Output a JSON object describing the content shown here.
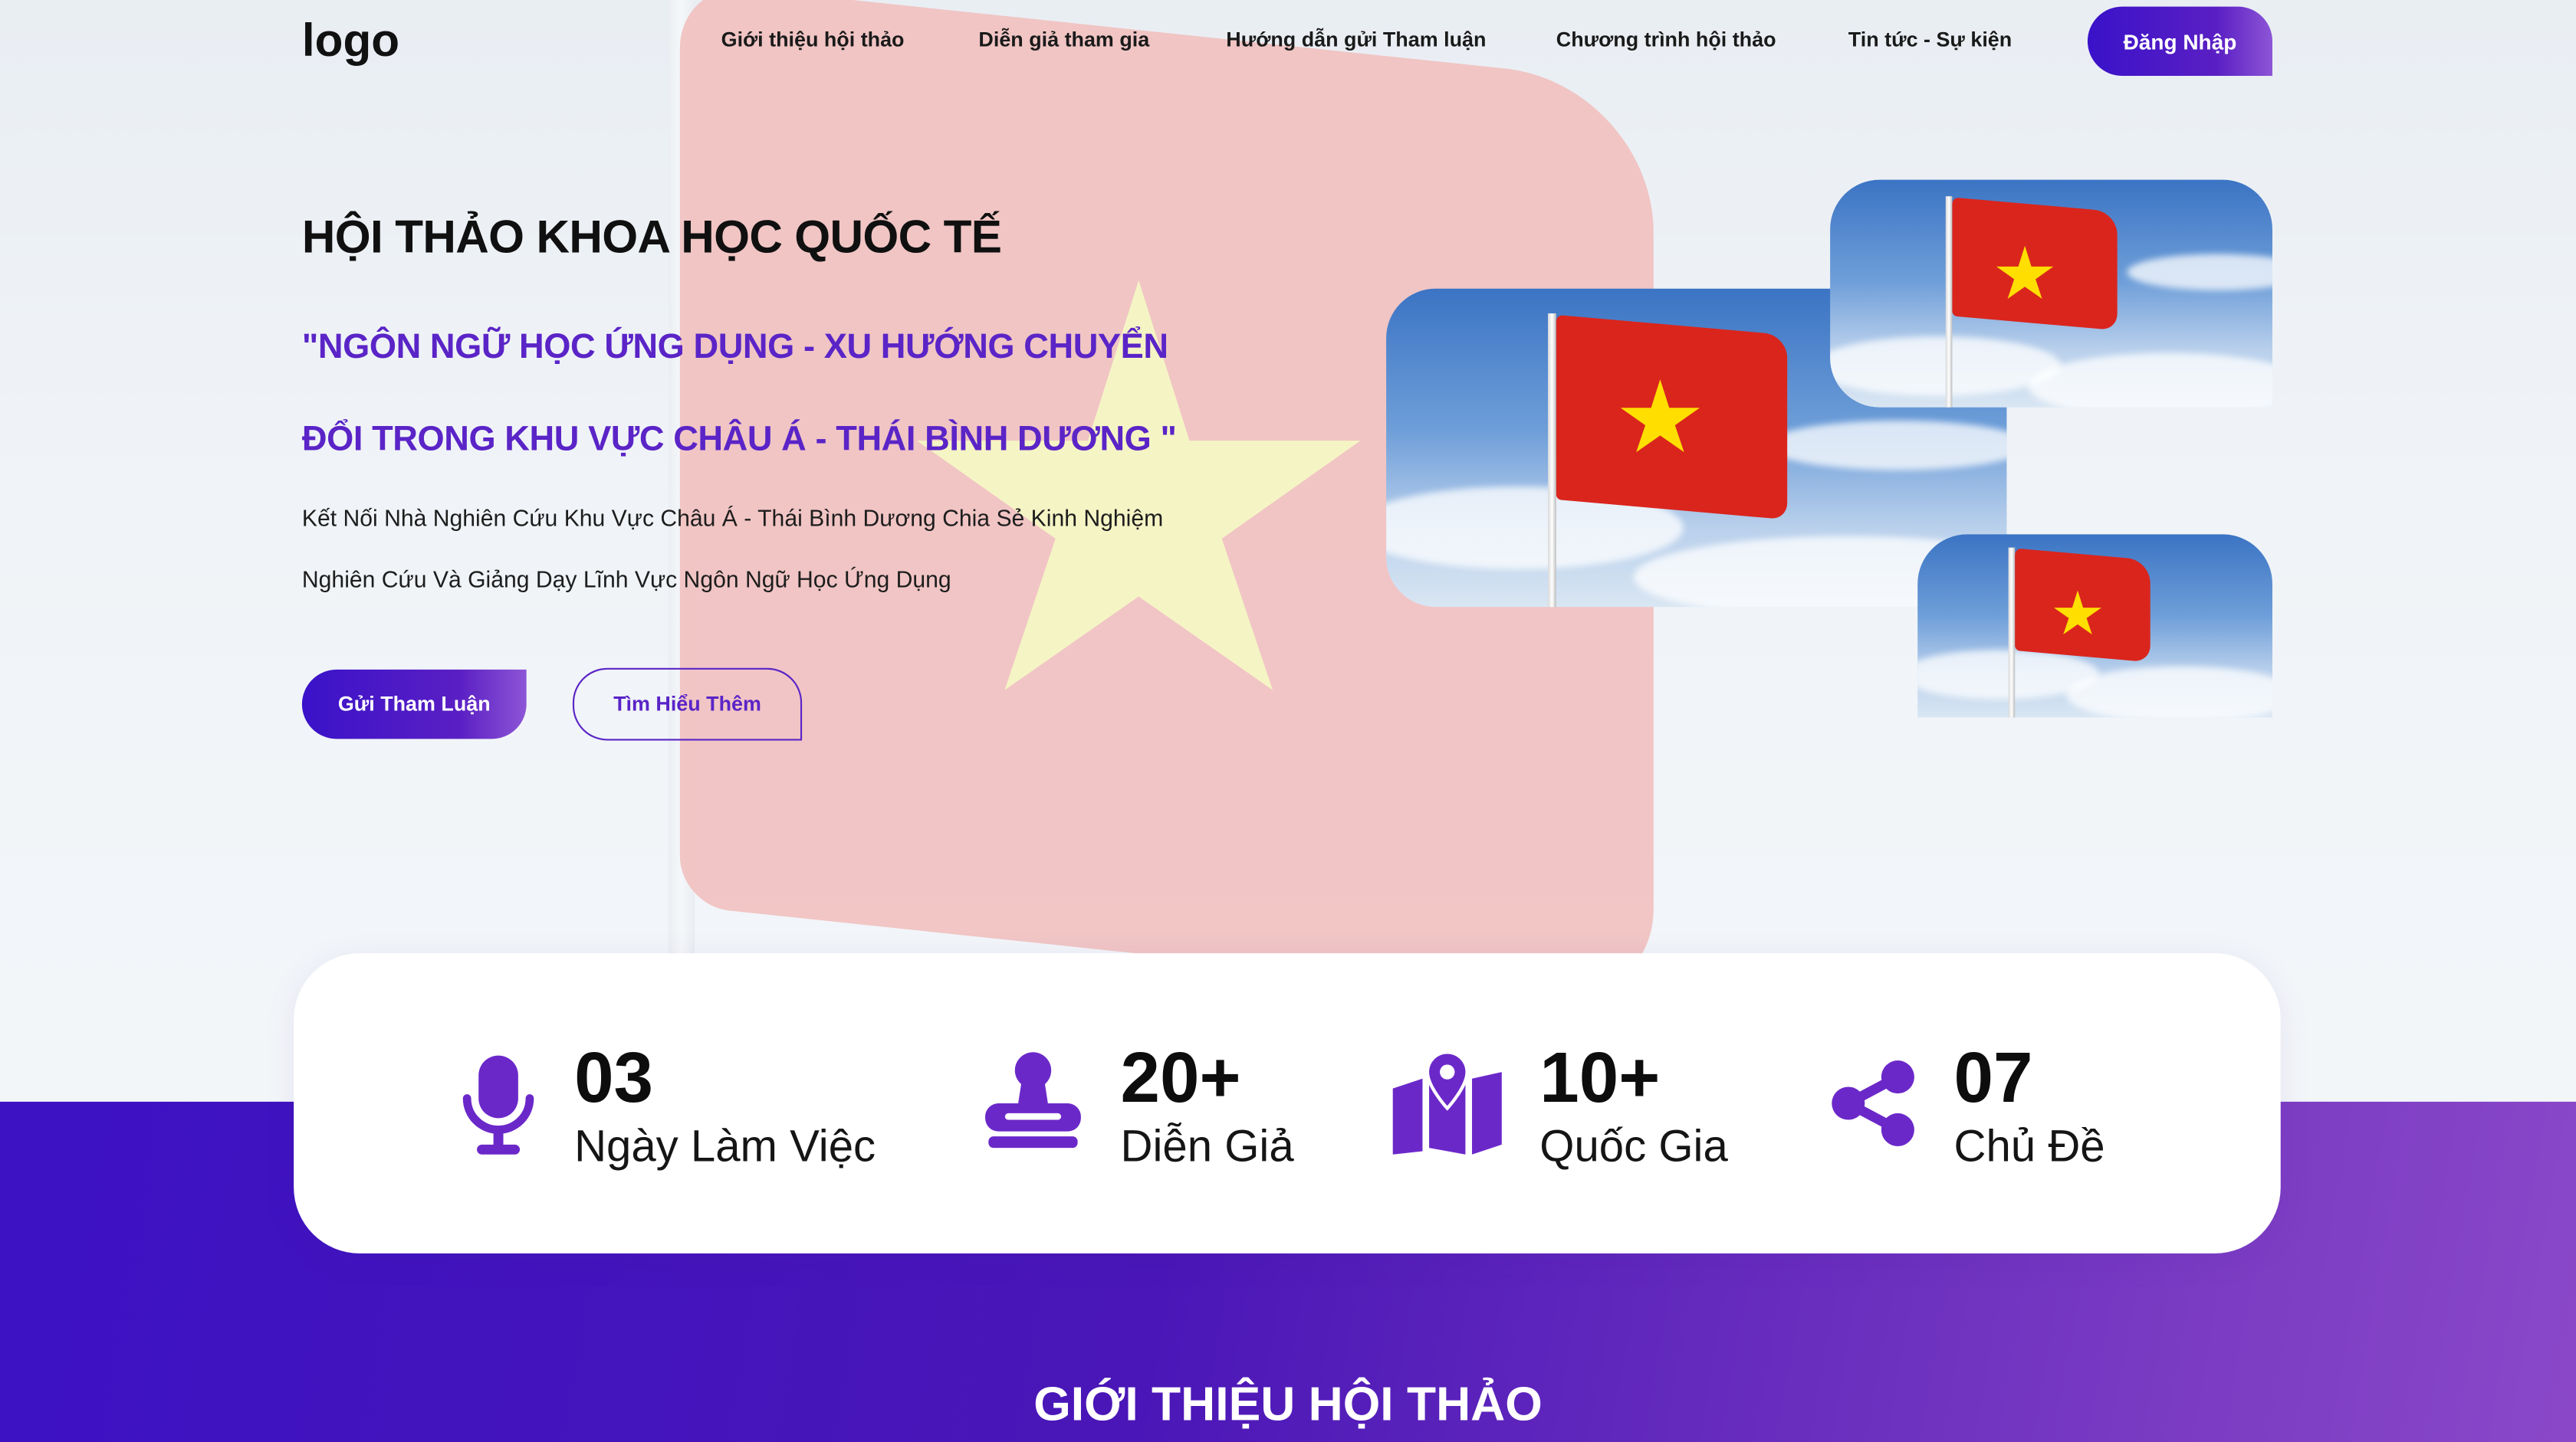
{
  "header": {
    "logo": "logo",
    "nav": [
      "Giới thiệu hội thảo",
      "Diễn giả tham gia",
      "Hướng dẫn gửi Tham luận",
      "Chương trình hội thảo",
      "Tin tức - Sự kiện"
    ],
    "login_label": "Đăng Nhập"
  },
  "hero": {
    "title": "HỘI THẢO KHOA HỌC QUỐC TẾ",
    "subtitle_line1": "\"NGÔN NGỮ HỌC ỨNG DỤNG - XU HƯỚNG CHUYỂN",
    "subtitle_line2": "ĐỔI TRONG KHU VỰC CHÂU Á - THÁI BÌNH DƯƠNG \"",
    "desc_line1": "Kết Nối Nhà Nghiên Cứu Khu Vực Châu Á - Thái Bình Dương Chia Sẻ Kinh Nghiệm",
    "desc_line2": "Nghiên Cứu Và Giảng Dạy Lĩnh Vực Ngôn Ngữ Học Ứng Dụng",
    "primary_button": "Gửi Tham Luận",
    "secondary_button": "Tìm Hiểu Thêm"
  },
  "stats": [
    {
      "icon": "microphone-icon",
      "number": "03",
      "label": "Ngày Làm Việc"
    },
    {
      "icon": "stamp-icon",
      "number": "20+",
      "label": "Diễn Giả"
    },
    {
      "icon": "map-location-icon",
      "number": "10+",
      "label": "Quốc Gia"
    },
    {
      "icon": "share-icon",
      "number": "07",
      "label": "Chủ Đề"
    }
  ],
  "section": {
    "title": "GIỚI THIỆU HỘI THẢO"
  },
  "colors": {
    "accent": "#5a24c7",
    "brand_dark": "#3a12c9",
    "flag_red": "#da251d",
    "flag_star": "#ffde00"
  }
}
